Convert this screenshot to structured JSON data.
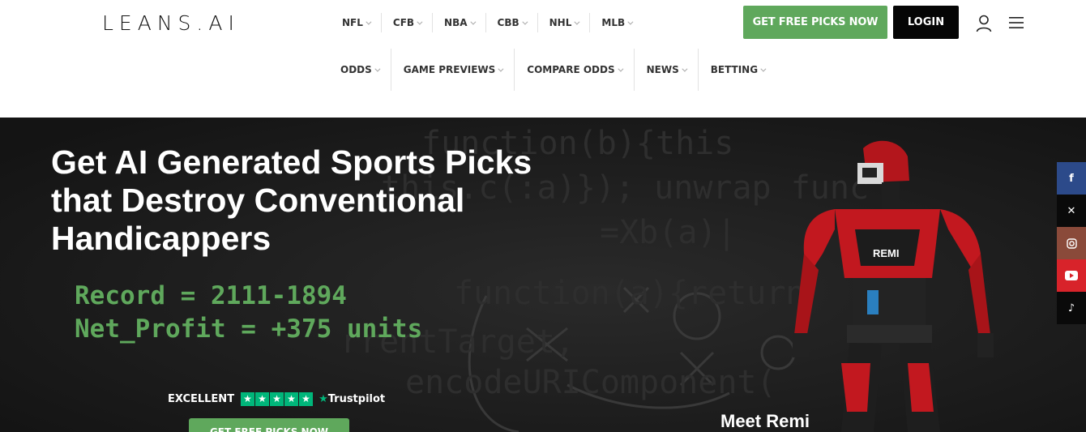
{
  "brand": {
    "logo_text": "LEANS.AI"
  },
  "nav_top": [
    "NFL",
    "CFB",
    "NBA",
    "CBB",
    "NHL",
    "MLB"
  ],
  "nav_bottom": [
    "ODDS",
    "GAME PREVIEWS",
    "COMPARE ODDS",
    "NEWS",
    "BETTING"
  ],
  "header": {
    "cta_label": "GET FREE PICKS NOW",
    "login_label": "LOGIN",
    "icons": [
      "user-icon",
      "hamburger-menu-icon"
    ]
  },
  "hero": {
    "title": "Get AI Generated Sports Picks that Destroy Conventional Handicappers",
    "record_line": "Record = 2111-1894",
    "profit_line": "Net_Profit = +375 units",
    "trust_label": "EXCELLENT",
    "trust_brand": "Trustpilot",
    "trust_stars": 5,
    "cta_label": "GET FREE PICKS NOW",
    "robot_caption": "Meet Remi",
    "robot_badge": "REMI"
  },
  "social": [
    "facebook-icon",
    "x-icon",
    "instagram-icon",
    "youtube-icon",
    "tiktok-icon"
  ],
  "colors": {
    "accent": "#5fa85c",
    "dark": "#050505",
    "hero_bg": "#1a1a1a",
    "trustpilot": "#00b67a"
  }
}
